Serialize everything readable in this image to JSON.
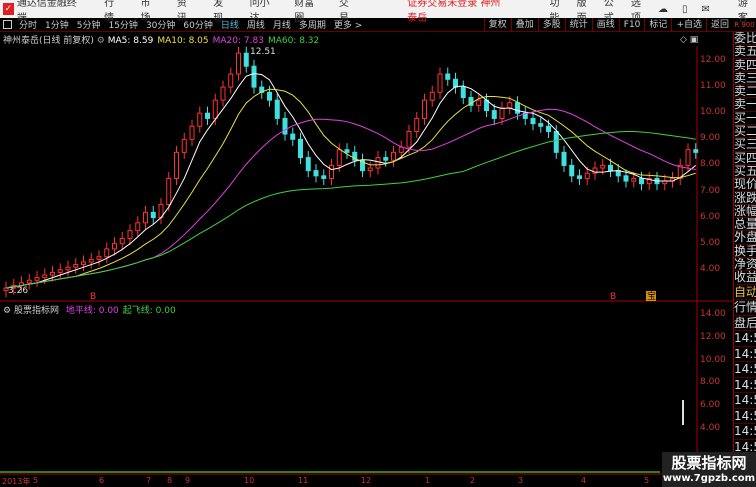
{
  "app": {
    "title": "通达信金融终端",
    "menu": [
      "行情",
      "市场",
      "资讯",
      "发现",
      "问小达",
      "财富圈",
      "交易"
    ],
    "notice": "证券交易未登录 神州泰岳",
    "right_menu": [
      "功能",
      "版面",
      "公式",
      "选项"
    ],
    "user": "游客"
  },
  "toolbar": {
    "periods": [
      "分时",
      "1分钟",
      "5分钟",
      "15分钟",
      "30分钟",
      "60分钟",
      "日线",
      "周线",
      "月线",
      "多周期",
      "更多 >"
    ],
    "active": "日线",
    "right_buttons": [
      "复权",
      "叠加",
      "多股",
      "统计",
      "画线",
      "F10",
      "标记",
      "+自选",
      "返回"
    ],
    "corner": "R 900"
  },
  "main": {
    "stock": "神州泰岳(日线 前复权)",
    "ma": [
      {
        "label": "MA5: 8.59",
        "color": "#ffffff"
      },
      {
        "label": "MA10: 8.05",
        "color": "#e8e040"
      },
      {
        "label": "MA20: 7.83",
        "color": "#e040e0"
      },
      {
        "label": "MA60: 8.32",
        "color": "#40d040"
      }
    ],
    "high_label": "12.51",
    "low_label": "3.26",
    "price_axis": [
      "12.00",
      "11.00",
      "10.00",
      "9.00",
      "8.00",
      "7.00",
      "6.00",
      "5.00",
      "4.00"
    ],
    "markers": [
      "B",
      "B",
      "宝"
    ]
  },
  "indicator": {
    "title": "股票指标网",
    "lines": [
      {
        "label": "地平线: 0.00",
        "color": "#e040e0"
      },
      {
        "label": "起飞线: 0.00",
        "color": "#40d040"
      }
    ],
    "axis": [
      "14.00",
      "12.00",
      "10.00",
      "8.00",
      "6.00",
      "4.00"
    ]
  },
  "date_axis": [
    "2013年",
    "5",
    "6",
    "7",
    "8",
    "9",
    "10",
    "11",
    "12",
    "1",
    "2",
    "3",
    "4",
    "5"
  ],
  "right_panel": [
    "委比",
    "卖五",
    "卖四",
    "卖三",
    "卖二",
    "卖一",
    "买一",
    "买二",
    "买三",
    "买四",
    "买五",
    "现价",
    "涨跌",
    "涨幅",
    "总量",
    "外盘",
    "换手",
    "净资",
    "收益",
    "自动",
    "行情",
    "盘后",
    "14:5",
    "14:5",
    "14:5",
    "14:5",
    "14:5",
    "14:5",
    "14:5",
    "14:5"
  ],
  "watermark": {
    "line1": "股票指标网",
    "line2": "www.7gpzb.com"
  },
  "chart_data": {
    "type": "candlestick",
    "ylim": [
      3,
      12.8
    ],
    "closes": [
      3.3,
      3.4,
      3.5,
      3.6,
      3.7,
      3.8,
      3.9,
      4.0,
      4.1,
      4.2,
      4.3,
      4.4,
      4.5,
      4.8,
      5.0,
      5.2,
      5.5,
      5.8,
      6.2,
      6.0,
      6.5,
      7.5,
      8.5,
      9.0,
      9.5,
      10.0,
      9.8,
      10.5,
      11.0,
      11.5,
      12.3,
      11.8,
      11.0,
      10.8,
      10.5,
      9.8,
      9.2,
      9.0,
      8.3,
      7.8,
      7.6,
      7.5,
      8.0,
      8.6,
      8.5,
      8.2,
      7.8,
      7.9,
      8.3,
      8.2,
      8.5,
      8.7,
      9.3,
      9.8,
      10.5,
      10.8,
      11.5,
      11.3,
      11.0,
      10.6,
      10.3,
      10.5,
      10.1,
      9.8,
      10.2,
      10.4,
      10.0,
      9.8,
      9.6,
      9.5,
      9.3,
      8.5,
      8.0,
      7.6,
      7.5,
      7.7,
      7.9,
      8.0,
      7.8,
      7.6,
      7.4,
      7.5,
      7.3,
      7.5,
      7.3,
      7.4,
      7.5,
      8.0,
      8.6,
      8.5
    ]
  }
}
